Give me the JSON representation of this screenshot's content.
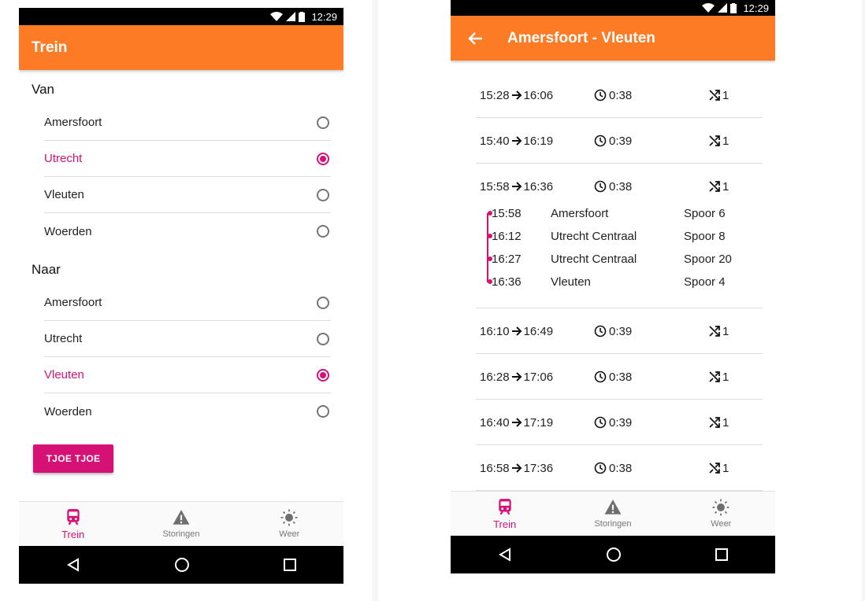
{
  "status": {
    "time": "12:29"
  },
  "left": {
    "title": "Trein",
    "van": {
      "label": "Van",
      "options": [
        "Amersfoort",
        "Utrecht",
        "Vleuten",
        "Woerden"
      ],
      "selected": "Utrecht"
    },
    "naar": {
      "label": "Naar",
      "options": [
        "Amersfoort",
        "Utrecht",
        "Vleuten",
        "Woerden"
      ],
      "selected": "Vleuten"
    },
    "button_label": "TJOE TJOE"
  },
  "right": {
    "title": "Amersfoort - Vleuten",
    "trips": [
      {
        "dep": "15:28",
        "arr": "16:06",
        "duration": "0:38",
        "transfers": "1"
      },
      {
        "dep": "15:40",
        "arr": "16:19",
        "duration": "0:39",
        "transfers": "1"
      },
      {
        "dep": "15:58",
        "arr": "16:36",
        "duration": "0:38",
        "transfers": "1",
        "stops": [
          {
            "time": "15:58",
            "station": "Amersfoort",
            "platform": "Spoor 6"
          },
          {
            "time": "16:12",
            "station": "Utrecht Centraal",
            "platform": "Spoor 8"
          },
          {
            "time": "16:27",
            "station": "Utrecht Centraal",
            "platform": "Spoor 20"
          },
          {
            "time": "16:36",
            "station": "Vleuten",
            "platform": "Spoor 4"
          }
        ]
      },
      {
        "dep": "16:10",
        "arr": "16:49",
        "duration": "0:39",
        "transfers": "1"
      },
      {
        "dep": "16:28",
        "arr": "17:06",
        "duration": "0:38",
        "transfers": "1"
      },
      {
        "dep": "16:40",
        "arr": "17:19",
        "duration": "0:39",
        "transfers": "1"
      },
      {
        "dep": "16:58",
        "arr": "17:36",
        "duration": "0:38",
        "transfers": "1"
      }
    ]
  },
  "nav": {
    "items": [
      {
        "label": "Trein",
        "icon": "train-icon",
        "active": true
      },
      {
        "label": "Storingen",
        "icon": "warning-icon",
        "active": false
      },
      {
        "label": "Weer",
        "icon": "sun-icon",
        "active": false
      }
    ]
  },
  "colors": {
    "appbar": "#fd7b25",
    "accent": "#d61176"
  }
}
